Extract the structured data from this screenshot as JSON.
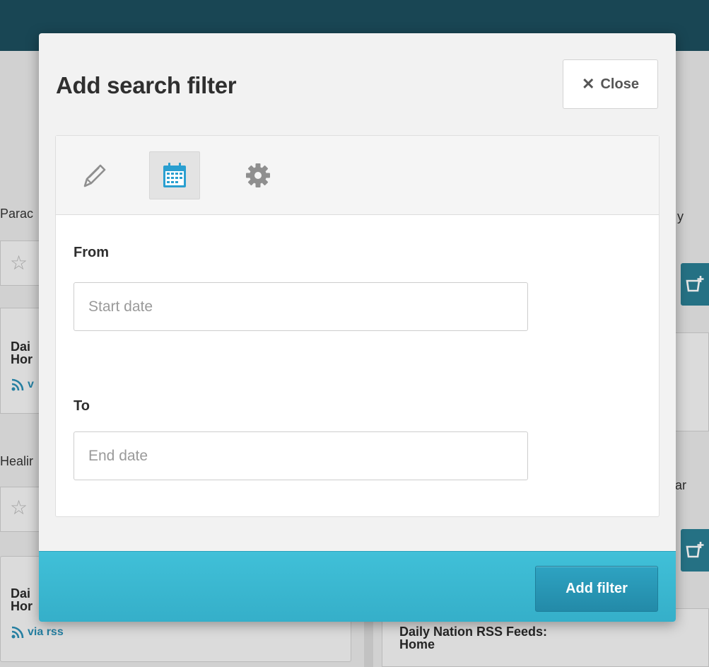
{
  "background": {
    "left_card_1_title_lines": [
      "Dai",
      "Hor"
    ],
    "left_card_1_via": "v",
    "left_card_2_title_lines": [
      "Dai",
      "Hor"
    ],
    "left_card_2_via": "via rss",
    "left_snippet_1": "Parac",
    "left_snippet_2": "Healir",
    "right_snippet_1": "y",
    "right_snippet_2": "ar",
    "right_card_title_lines": [
      "Daily Nation RSS Feeds:",
      "Home"
    ],
    "icons": [
      "star-outline-icon",
      "rss-icon",
      "bucket-add-icon"
    ]
  },
  "modal": {
    "title": "Add search filter",
    "close_label": "Close",
    "tabs": [
      {
        "icon": "pencil-icon",
        "active": false
      },
      {
        "icon": "calendar-icon",
        "active": true
      },
      {
        "icon": "gear-icon",
        "active": false
      }
    ],
    "from": {
      "label": "From",
      "placeholder": "Start date",
      "value": ""
    },
    "to": {
      "label": "To",
      "placeholder": "End date",
      "value": ""
    },
    "submit_label": "Add filter",
    "colors": {
      "footer": "#3bb8d2",
      "submit": "#2896b5",
      "calendar_icon": "#2a9fd0"
    }
  }
}
